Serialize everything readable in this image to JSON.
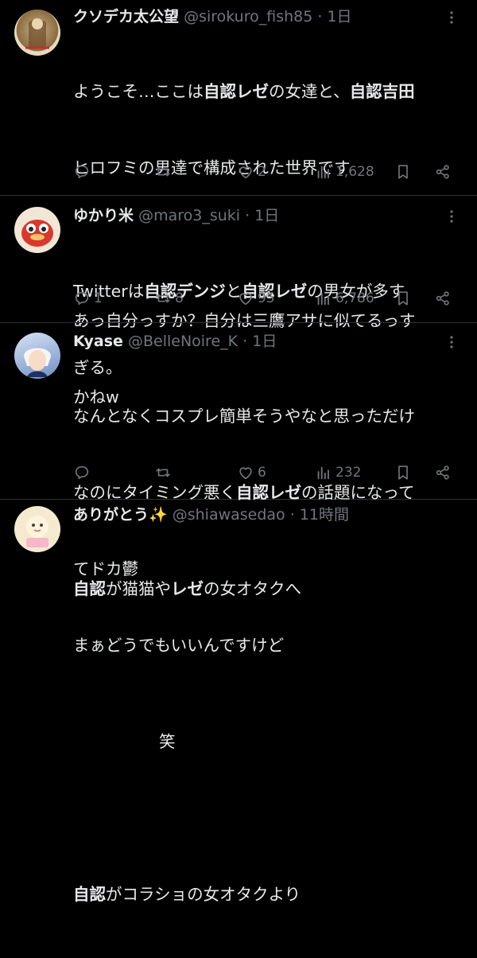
{
  "tweets": [
    {
      "name": "クソデカ太公望",
      "handle": "@sirokuro_fish85",
      "time": "1日",
      "body1": "ようこそ…ここは",
      "body1b": "自認レゼ",
      "body1c": "の女達と、",
      "body1d": "自認吉田",
      "body2": "ヒロフミの男達で構成された世界です",
      "body3": "あっ自分っすか？自分は三鷹アサに似てるっす",
      "body4": "かねw",
      "replies": "",
      "retweets": "",
      "likes": "2",
      "views": "1,628"
    },
    {
      "name": "ゆかり米",
      "handle": "@maro3_suki",
      "time": "1日",
      "body1a": "Twitterは",
      "body1b": "自認デンジ",
      "body1c": "と",
      "body1d": "自認レゼ",
      "body1e": "の男女が多す",
      "body2": "ぎる。",
      "replies": "1",
      "retweets": "8",
      "likes": "95",
      "views": "6,786"
    },
    {
      "name": "Kyase",
      "handle": "@BelleNoire_K",
      "time": "1日",
      "body1": "なんとなくコスプレ簡単そうやなと思っただけ",
      "body2a": "なのにタイミング悪く",
      "body2b": "自認レゼ",
      "body2c": "の話題になって",
      "body3": "てドカ鬱",
      "body4": "まぁどうでもいいんですけど",
      "replies": "",
      "retweets": "",
      "likes": "6",
      "views": "232"
    },
    {
      "name": "ありがとう✨",
      "handle": "@shiawasedao",
      "time": "11時間",
      "body1a": "自認",
      "body1b": "が猫猫や",
      "body1c": "レゼ",
      "body1d": "の女オタクへ",
      "body2": "笑",
      "body3a": "自認",
      "body3b": "がコラショの女オタクより"
    }
  ],
  "sep": "·",
  "icons": [
    "reply-icon",
    "retweet-icon",
    "like-icon",
    "views-icon",
    "bookmark-icon",
    "share-icon",
    "more-icon"
  ]
}
